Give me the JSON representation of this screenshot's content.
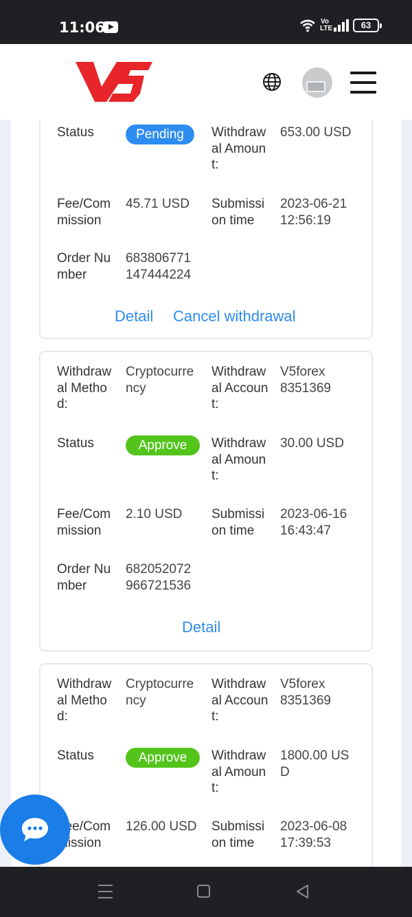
{
  "status_bar": {
    "time": "11:06",
    "volte": "Vo\nLTE",
    "battery": "63"
  },
  "header": {
    "logo_text": "V5"
  },
  "labels": {
    "withdrawal_method": "Withdraw\nal Metho\nd:",
    "withdrawal_account": "Withdraw\nal Accoun\nt:",
    "status": "Status",
    "withdrawal_amount": "Withdraw\nal Amoun\nt:",
    "fee": "Fee/Com\nmission",
    "submission_time": "Submissi\non time",
    "order_number": "Order Nu\nmber"
  },
  "cards": [
    {
      "status": "Pending",
      "amount": "653.00 USD",
      "fee": "45.71 USD",
      "submission_time": "2023-06-21\n12:56:19",
      "order_number": "683806771\n147444224",
      "detail_label": "Detail",
      "cancel_label": "Cancel withdrawal"
    },
    {
      "method": "Cryptocurre\nncy",
      "account": "V5forex\n8351369",
      "status": "Approve",
      "amount": "30.00 USD",
      "fee": "2.10 USD",
      "submission_time": "2023-06-16\n16:43:47",
      "order_number": "682052072\n966721536",
      "detail_label": "Detail"
    },
    {
      "method": "Cryptocurre\nncy",
      "account": "V5forex\n8351369",
      "status": "Approve",
      "amount": "1800.00 US\nD",
      "fee": "126.00 USD",
      "submission_time": "2023-06-08\n17:39:53"
    }
  ],
  "colors": {
    "pending": "#2d8cf0",
    "approve": "#52c41a",
    "link": "#2d8cf0",
    "fab": "#1a7de8",
    "logo": "#e8252a"
  },
  "icons": {
    "globe": "globe-icon",
    "chat": "chat-icon",
    "menu": "hamburger-menu-icon"
  }
}
